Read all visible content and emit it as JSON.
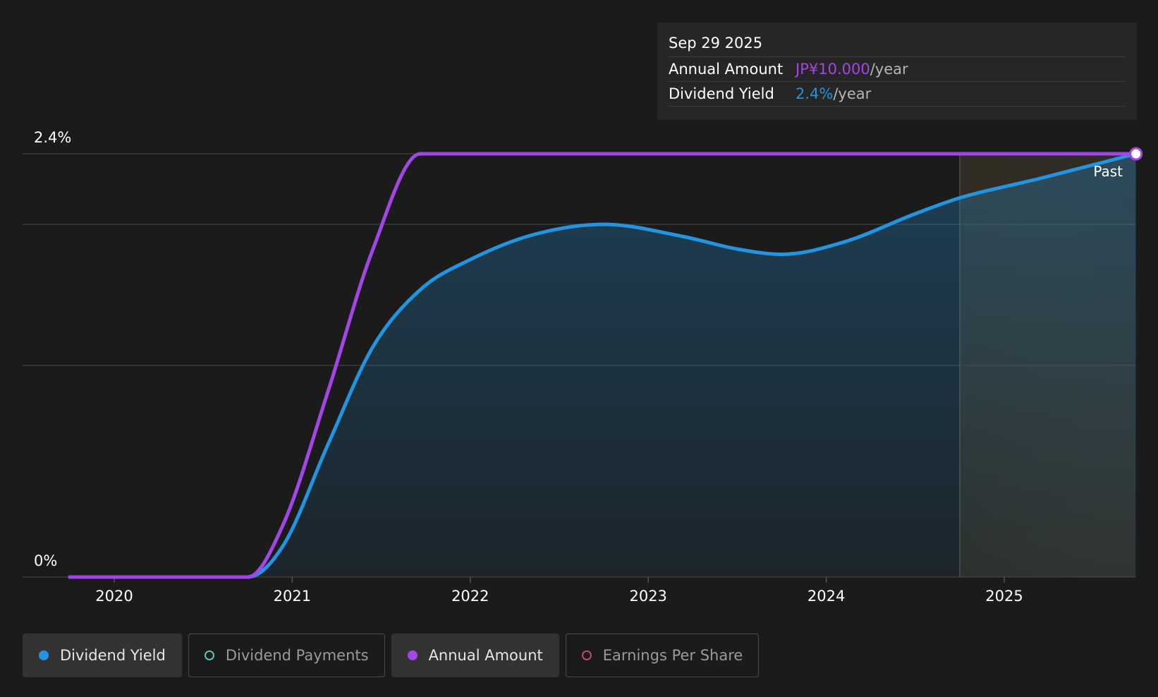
{
  "chart_data": {
    "type": "line",
    "x_ticks": [
      "2020",
      "2021",
      "2022",
      "2023",
      "2024",
      "2025"
    ],
    "y_axis_labels": {
      "top": "2.4%",
      "bottom": "0%"
    },
    "ylim": [
      0,
      2.4
    ],
    "series": [
      {
        "name": "Dividend Yield",
        "color": "#2394df",
        "area_fill": true,
        "points": [
          {
            "x": 2019.75,
            "y": 0.0
          },
          {
            "x": 2020.75,
            "y": 0.0
          },
          {
            "x": 2020.95,
            "y": 0.18
          },
          {
            "x": 2021.2,
            "y": 0.75
          },
          {
            "x": 2021.45,
            "y": 1.3
          },
          {
            "x": 2021.72,
            "y": 1.63
          },
          {
            "x": 2022.0,
            "y": 1.8
          },
          {
            "x": 2022.35,
            "y": 1.94
          },
          {
            "x": 2022.75,
            "y": 2.0
          },
          {
            "x": 2023.2,
            "y": 1.93
          },
          {
            "x": 2023.5,
            "y": 1.86
          },
          {
            "x": 2023.75,
            "y": 1.83
          },
          {
            "x": 2024.1,
            "y": 1.9
          },
          {
            "x": 2024.5,
            "y": 2.06
          },
          {
            "x": 2024.75,
            "y": 2.15
          },
          {
            "x": 2025.2,
            "y": 2.26
          },
          {
            "x": 2025.74,
            "y": 2.4
          }
        ]
      },
      {
        "name": "Annual Amount",
        "color": "#a246e6",
        "area_fill": false,
        "points": [
          {
            "x": 2019.75,
            "y": 0.0
          },
          {
            "x": 2020.75,
            "y": 0.0
          },
          {
            "x": 2020.95,
            "y": 0.3
          },
          {
            "x": 2021.2,
            "y": 1.05
          },
          {
            "x": 2021.45,
            "y": 1.85
          },
          {
            "x": 2021.72,
            "y": 2.4
          },
          {
            "x": 2025.74,
            "y": 2.4
          }
        ]
      }
    ],
    "past_region_start": 2024.75,
    "past_label": "Past",
    "marker_x": 2025.74
  },
  "tooltip": {
    "date": "Sep 29 2025",
    "rows": [
      {
        "label": "Annual Amount",
        "value": "JP¥10.000",
        "unit": "/year",
        "color": "#a246e6"
      },
      {
        "label": "Dividend Yield",
        "value": "2.4%",
        "unit": "/year",
        "color": "#2394df"
      }
    ]
  },
  "legend": [
    {
      "label": "Dividend Yield",
      "color": "#2394df",
      "active": true
    },
    {
      "label": "Dividend Payments",
      "color": "#5ec7b0",
      "active": false
    },
    {
      "label": "Annual Amount",
      "color": "#a246e6",
      "active": true
    },
    {
      "label": "Earnings Per Share",
      "color": "#c0487d",
      "active": false
    }
  ]
}
